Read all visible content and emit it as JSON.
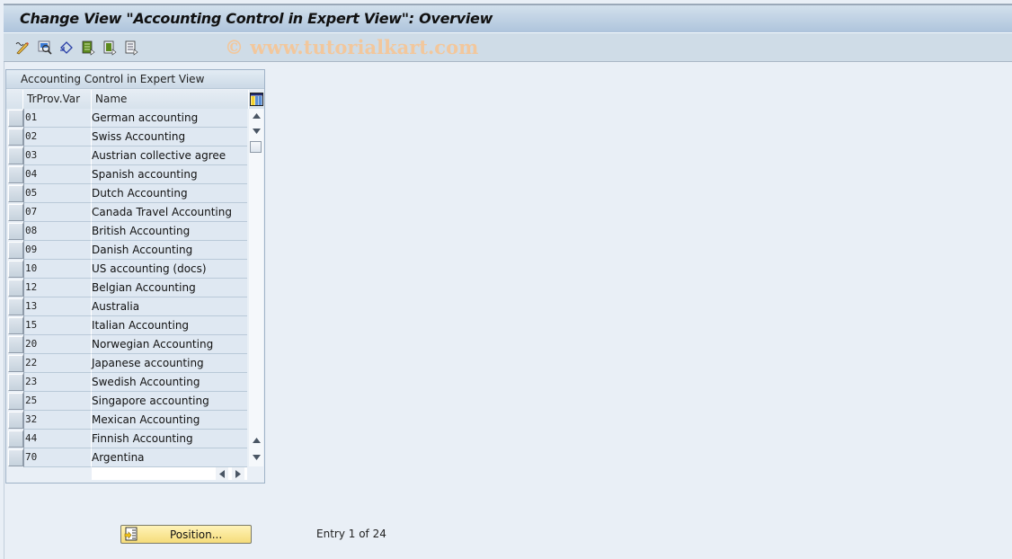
{
  "window": {
    "title": "Change View \"Accounting Control in Expert View\": Overview"
  },
  "toolbar": {
    "icons": [
      {
        "name": "display-change-icon",
        "tooltip": ""
      },
      {
        "name": "find-icon",
        "tooltip": ""
      },
      {
        "name": "undo-change-icon",
        "tooltip": ""
      },
      {
        "name": "select-all-icon",
        "tooltip": ""
      },
      {
        "name": "select-block-icon",
        "tooltip": ""
      },
      {
        "name": "deselect-all-icon",
        "tooltip": ""
      }
    ],
    "watermark": "© www.tutorialkart.com"
  },
  "table": {
    "title": "Accounting Control in Expert View",
    "columns": [
      "TrProv.Var",
      "Name"
    ],
    "rows": [
      {
        "code": "01",
        "name": "German accounting"
      },
      {
        "code": "02",
        "name": "Swiss Accounting"
      },
      {
        "code": "03",
        "name": "Austrian collective agree"
      },
      {
        "code": "04",
        "name": "Spanish accounting"
      },
      {
        "code": "05",
        "name": "Dutch Accounting"
      },
      {
        "code": "07",
        "name": "Canada Travel Accounting"
      },
      {
        "code": "08",
        "name": "British Accounting"
      },
      {
        "code": "09",
        "name": "Danish Accounting"
      },
      {
        "code": "10",
        "name": "US accounting (docs)"
      },
      {
        "code": "12",
        "name": "Belgian Accounting"
      },
      {
        "code": "13",
        "name": "Australia"
      },
      {
        "code": "15",
        "name": "Italian Accounting"
      },
      {
        "code": "20",
        "name": "Norwegian Accounting"
      },
      {
        "code": "22",
        "name": "Japanese accounting"
      },
      {
        "code": "23",
        "name": "Swedish Accounting"
      },
      {
        "code": "25",
        "name": "Singapore accounting"
      },
      {
        "code": "32",
        "name": "Mexican Accounting"
      },
      {
        "code": "44",
        "name": "Finnish Accounting"
      },
      {
        "code": "70",
        "name": "Argentina"
      }
    ]
  },
  "footer": {
    "position_button": "Position...",
    "entry_text": "Entry 1 of 24"
  },
  "colors": {
    "title_bar": "#aec4dc",
    "toolbar": "#cfdce7",
    "background": "#e9eff6",
    "row_bg": "#dfe8f2",
    "button_yellow": "#f5dc7a",
    "watermark": "#f2c79c"
  }
}
